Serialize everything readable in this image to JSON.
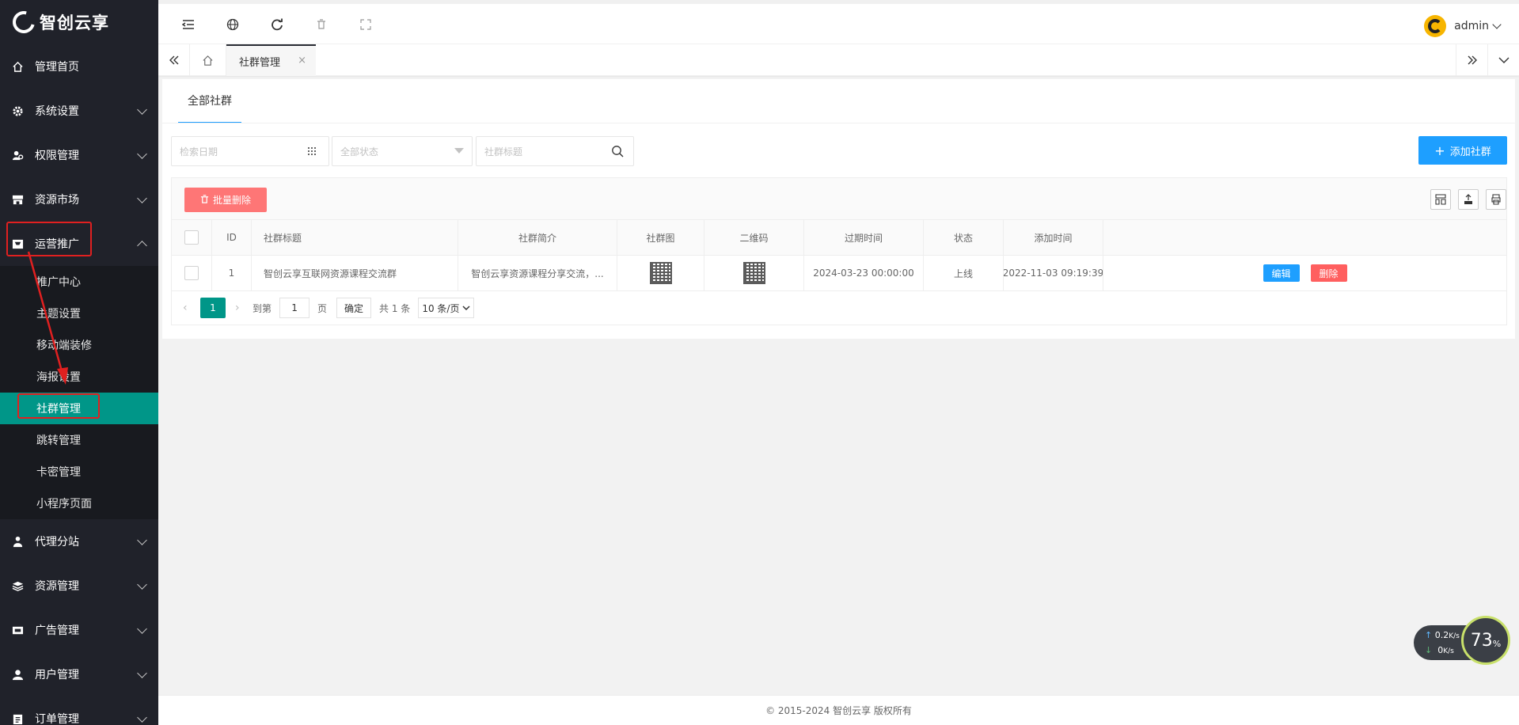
{
  "app": {
    "logo_text": "智创云享"
  },
  "sidebar": {
    "items": [
      {
        "label": "管理首页",
        "icon": "home-icon"
      },
      {
        "label": "系统设置",
        "icon": "gear-icon"
      },
      {
        "label": "权限管理",
        "icon": "permission-icon"
      },
      {
        "label": "资源市场",
        "icon": "store-icon"
      },
      {
        "label": "运营推广",
        "icon": "promotion-icon"
      },
      {
        "label": "代理分站",
        "icon": "agent-icon"
      },
      {
        "label": "资源管理",
        "icon": "layers-icon"
      },
      {
        "label": "广告管理",
        "icon": "ad-icon"
      },
      {
        "label": "用户管理",
        "icon": "user-icon"
      },
      {
        "label": "订单管理",
        "icon": "order-icon"
      }
    ],
    "submenu": [
      {
        "label": "推广中心"
      },
      {
        "label": "主题设置"
      },
      {
        "label": "移动端装修"
      },
      {
        "label": "海报设置"
      },
      {
        "label": "社群管理"
      },
      {
        "label": "跳转管理"
      },
      {
        "label": "卡密管理"
      },
      {
        "label": "小程序页面"
      }
    ]
  },
  "header": {
    "user": "admin"
  },
  "tabs": {
    "active": "社群管理",
    "close": "×"
  },
  "card": {
    "tab": "全部社群",
    "filters": {
      "date_placeholder": "检索日期",
      "status_placeholder": "全部状态",
      "title_placeholder": "社群标题"
    },
    "add_button": "添加社群",
    "batch_delete": "批量删除"
  },
  "table": {
    "columns": [
      "ID",
      "社群标题",
      "社群简介",
      "社群图",
      "二维码",
      "过期时间",
      "状态",
      "添加时间"
    ],
    "rows": [
      {
        "id": "1",
        "title": "智创云享互联网资源课程交流群",
        "intro": "智创云享资源课程分享交流，...",
        "expire": "2024-03-23 00:00:00",
        "status": "上线",
        "added": "2022-11-03 09:19:39",
        "edit": "编辑",
        "remove": "删除"
      }
    ]
  },
  "pager": {
    "current": "1",
    "goto_label": "到第",
    "page_input": "1",
    "page_unit": "页",
    "confirm": "确定",
    "total": "共 1 条",
    "per_page": "10 条/页"
  },
  "footer": {
    "copyright": "© 2015-2024 智创云享 版权所有"
  },
  "net_widget": {
    "up": "0.2",
    "down": "0",
    "unit": "K/s",
    "percent": "73",
    "percent_sign": "%"
  },
  "colors": {
    "sidebar_bg": "#20222a",
    "accent_teal": "#009688",
    "primary_blue": "#1e9fff",
    "danger_red": "#ff5f5f",
    "annotation_red": "#e02020"
  }
}
